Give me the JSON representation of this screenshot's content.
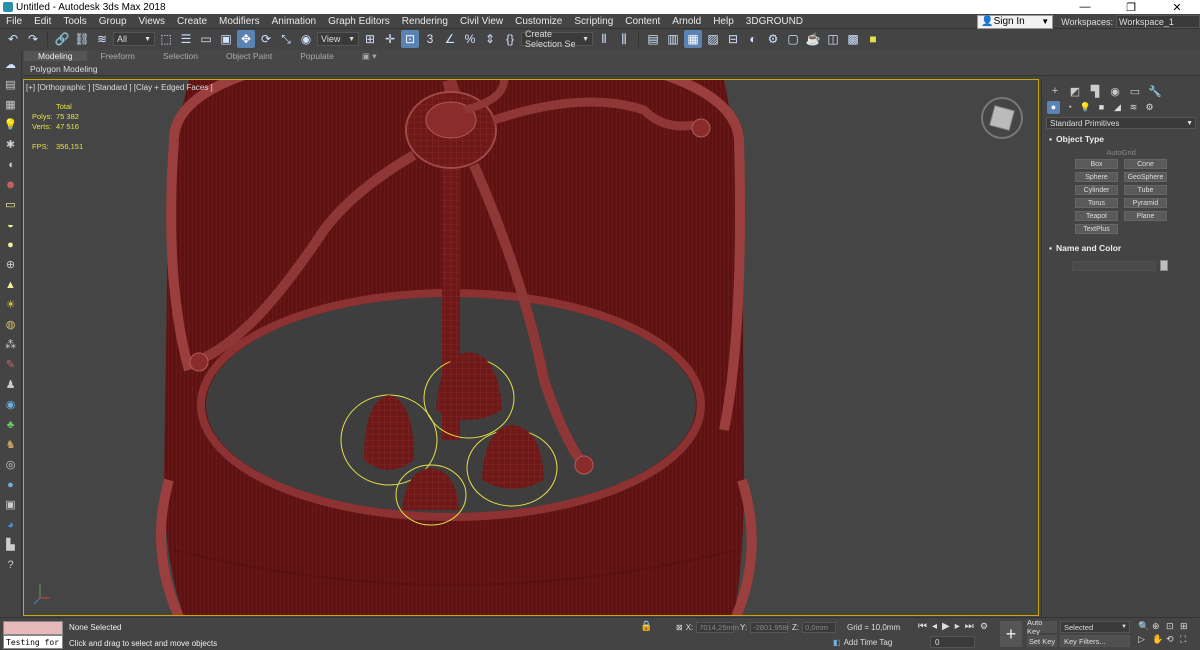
{
  "window": {
    "title": "Untitled - Autodesk 3ds Max 2018",
    "controls": [
      "—",
      "❐",
      "✕"
    ]
  },
  "menu": {
    "items": [
      "File",
      "Edit",
      "Tools",
      "Group",
      "Views",
      "Create",
      "Modifiers",
      "Animation",
      "Graph Editors",
      "Rendering",
      "Civil View",
      "Customize",
      "Scripting",
      "Content",
      "Arnold",
      "Help",
      "3DGROUND"
    ],
    "sign_in": "Sign In",
    "workspaces_label": "Workspaces:",
    "workspace_value": "Workspace_1"
  },
  "toolbar": {
    "selection_filter": "All",
    "ref_coord": "View",
    "named_selection": "Create Selection Se"
  },
  "ribbon": {
    "tabs": [
      "Modeling",
      "Freeform",
      "Selection",
      "Object Paint",
      "Populate"
    ],
    "sub_label": "Polygon Modeling"
  },
  "viewport": {
    "label": "[+] [Orthographic ] [Standard ] [Clay + Edged Faces ]",
    "stats_header": "Total",
    "polys_label": "Polys:",
    "polys_value": "75 382",
    "verts_label": "Verts:",
    "verts_value": "47 516",
    "fps_label": "FPS:",
    "fps_value": "356,151"
  },
  "command_panel": {
    "category": "Standard Primitives",
    "object_type_title": "Object Type",
    "autogrid": "AutoGrid",
    "object_buttons": [
      "Box",
      "Cone",
      "Sphere",
      "GeoSphere",
      "Cylinder",
      "Tube",
      "Torus",
      "Pyramid",
      "Teapot",
      "Plane",
      "TextPlus"
    ],
    "name_color_title": "Name and Color"
  },
  "status": {
    "maxscript_text": "Testing for :",
    "selection": "None Selected",
    "prompt": "Click and drag to select and move objects",
    "x_label": "X:",
    "x_value": "7014,25mm",
    "y_label": "Y:",
    "y_value": "-2801,958r",
    "z_label": "Z:",
    "z_value": "0,0mm",
    "grid": "Grid = 10,0mm",
    "add_time_tag": "Add Time Tag",
    "frame": "0",
    "auto_key": "Auto Key",
    "set_key": "Set Key",
    "key_filter_dd": "Selected",
    "key_filters": "Key Filters..."
  },
  "colors": {
    "model": "#7a1e1e",
    "model_light": "#a24040",
    "selection_outline": "#e6e04a",
    "viewport_border": "#c8a800",
    "accent": "#5a82b3"
  }
}
